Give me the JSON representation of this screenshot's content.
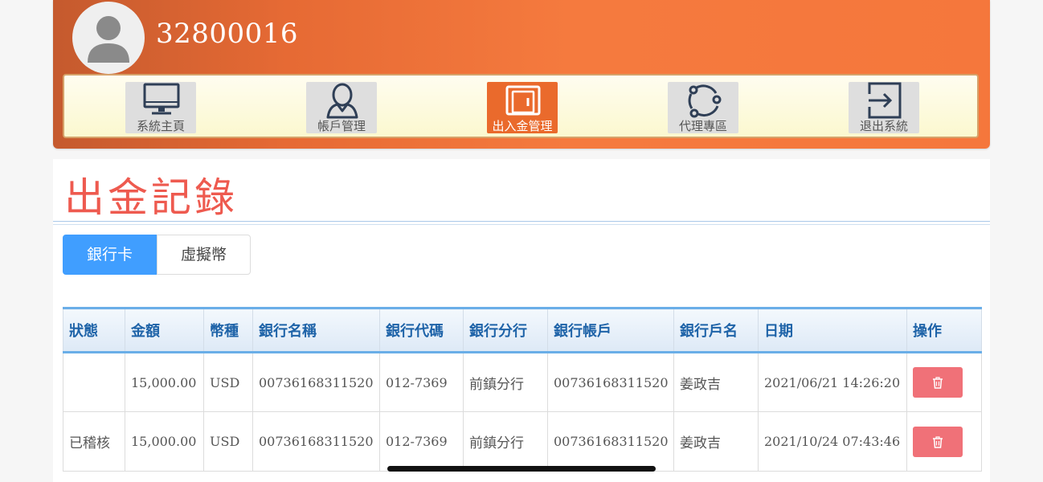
{
  "header": {
    "username": "32800016",
    "nav": [
      {
        "label": "系統主頁",
        "icon": "monitor-icon",
        "active": false
      },
      {
        "label": "帳戶管理",
        "icon": "user-icon",
        "active": false
      },
      {
        "label": "出入金管理",
        "icon": "wallet-icon",
        "active": true
      },
      {
        "label": "代理專區",
        "icon": "share-icon",
        "active": false
      },
      {
        "label": "退出系統",
        "icon": "logout-icon",
        "active": false
      }
    ]
  },
  "page": {
    "title": "出金記錄",
    "tabs": [
      {
        "label": "銀行卡",
        "active": true
      },
      {
        "label": "虛擬幣",
        "active": false
      }
    ]
  },
  "table": {
    "columns": [
      "狀態",
      "金額",
      "幣種",
      "銀行名稱",
      "銀行代碼",
      "銀行分行",
      "銀行帳戶",
      "銀行戶名",
      "日期",
      "操作"
    ],
    "rows": [
      {
        "status": "",
        "amount": "15,000.00",
        "currency": "USD",
        "bank_name": "00736168311520",
        "bank_code": "012-7369",
        "branch": "前鎮分行",
        "account": "00736168311520",
        "holder": "姜政吉",
        "date": "2021/06/21 14:26:20"
      },
      {
        "status": "已稽核",
        "amount": "15,000.00",
        "currency": "USD",
        "bank_name": "00736168311520",
        "bank_code": "012-7369",
        "branch": "前鎮分行",
        "account": "00736168311520",
        "holder": "姜政吉",
        "date": "2021/10/24 07:43:46"
      }
    ]
  },
  "colors": {
    "header_orange": "#f5773c",
    "title_red": "#ee5a4f",
    "tab_blue": "#409eff",
    "delete_red": "#f07178",
    "table_header_text": "#1e63a8"
  }
}
